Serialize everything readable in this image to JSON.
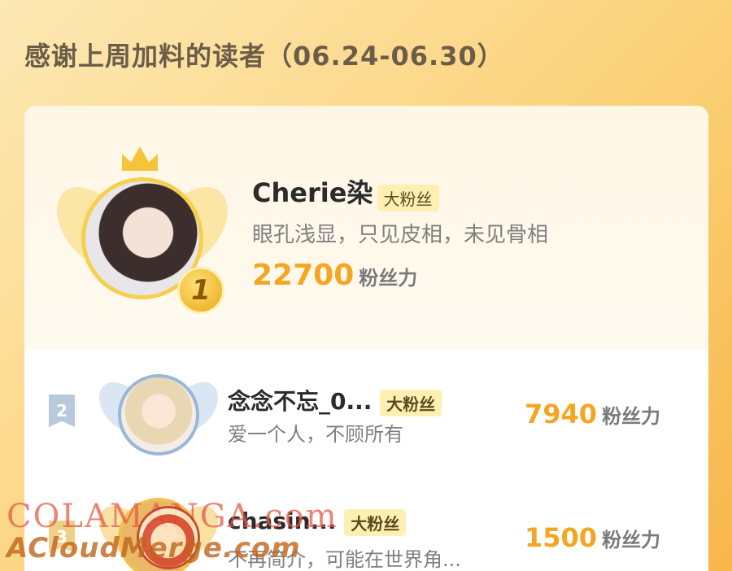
{
  "header": {
    "title": "感谢上周加料的读者（06.24-06.30）"
  },
  "ranks": [
    {
      "rank": "1",
      "name": "Cherie染",
      "tag": "大粉丝",
      "bio": "眼孔浅显，只见皮相，未见骨相",
      "score": "22700",
      "unit": "粉丝力"
    },
    {
      "rank": "2",
      "name": "念念不忘_0...",
      "tag": "大粉丝",
      "bio": "爱一个人，不顾所有",
      "score": "7940",
      "unit": "粉丝力"
    },
    {
      "rank": "3",
      "name": "chasin...",
      "tag": "大粉丝",
      "bio": "不再简介，可能在世界角...",
      "score": "1500",
      "unit": "粉丝力"
    }
  ],
  "watermark": {
    "line1": "COLAMANGA.com",
    "line2": "ACloudMerge.com"
  },
  "colors": {
    "accent": "#f4a623",
    "tag_bg": "#fdf0b2",
    "background": "#fbd27a"
  }
}
